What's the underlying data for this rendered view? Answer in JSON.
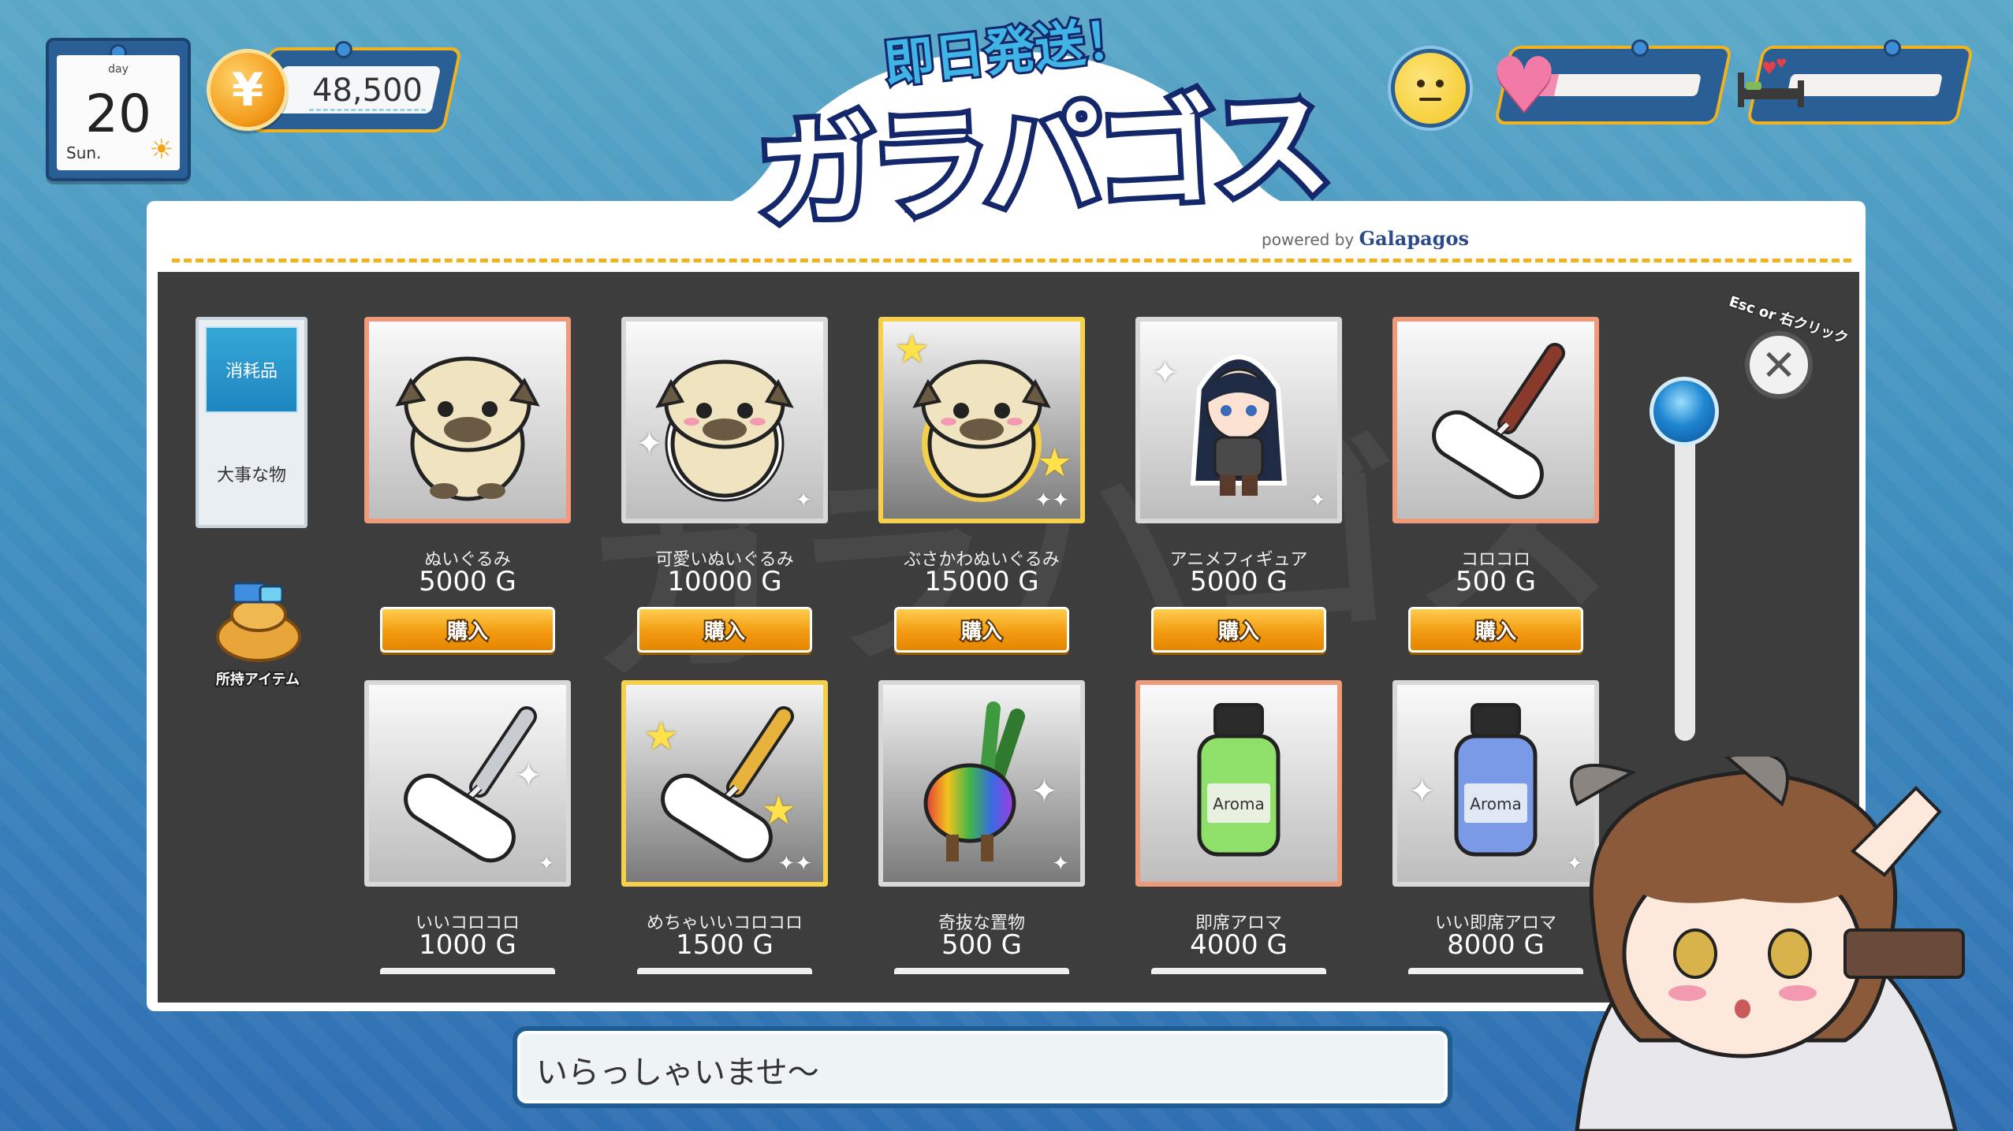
{
  "calendar": {
    "day_label": "day",
    "day": "20",
    "weekday": "Sun."
  },
  "money": {
    "currency_symbol": "¥",
    "amount": "48,500"
  },
  "stats": {
    "affection_level": 0.12,
    "fatigue_level": 0.0
  },
  "logo": {
    "subtitle": "即日発送！",
    "title": "ガラパゴス",
    "powered_prefix": "powered by",
    "powered_brand": "Galapagos"
  },
  "tabs": [
    {
      "label": "消耗品",
      "active": true
    },
    {
      "label": "大事な物",
      "active": false
    }
  ],
  "inventory": {
    "label": "所持アイテム"
  },
  "close": {
    "hint": "Esc or 右クリック"
  },
  "buy_label": "購入",
  "items": [
    {
      "name": "ぬいぐるみ",
      "price": "5000 G",
      "icon": "plush-pug-icon"
    },
    {
      "name": "可愛いぬいぐるみ",
      "price": "10000 G",
      "icon": "cute-plush-pug-icon"
    },
    {
      "name": "ぶさかわぬいぐるみ",
      "price": "15000 G",
      "icon": "ugly-cute-plush-pug-icon"
    },
    {
      "name": "アニメフィギュア",
      "price": "5000 G",
      "icon": "anime-figure-icon"
    },
    {
      "name": "コロコロ",
      "price": "500 G",
      "icon": "lint-roller-icon"
    },
    {
      "name": "いいコロコロ",
      "price": "1000 G",
      "icon": "good-lint-roller-icon"
    },
    {
      "name": "めちゃいいコロコロ",
      "price": "1500 G",
      "icon": "great-lint-roller-icon"
    },
    {
      "name": "奇抜な置物",
      "price": "500 G",
      "icon": "weird-ornament-icon"
    },
    {
      "name": "即席アロマ",
      "price": "4000 G",
      "icon": "instant-aroma-icon"
    },
    {
      "name": "いい即席アロマ",
      "price": "8000 G",
      "icon": "good-instant-aroma-icon"
    }
  ],
  "aroma_label": "Aroma",
  "dialog": {
    "text": "いらっしゃいませ〜"
  },
  "colors": {
    "accent": "#f0b21d",
    "frame": "#2a5f96",
    "panel": "#3d3d3d",
    "buy": "#f39b12"
  }
}
